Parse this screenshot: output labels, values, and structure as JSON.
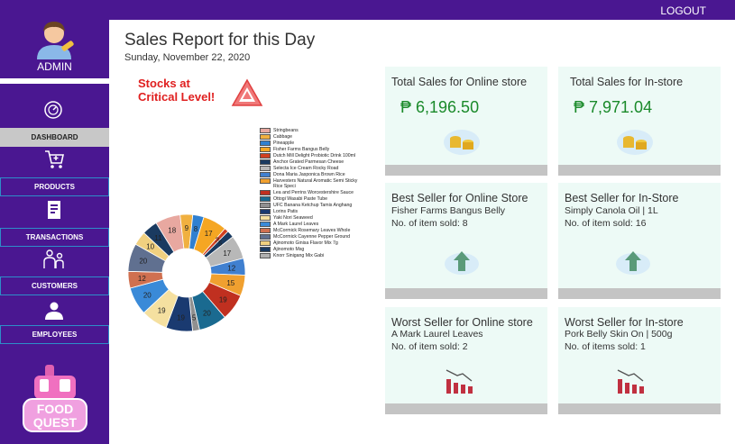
{
  "header": {
    "logout_label": "LOGOUT"
  },
  "sidebar": {
    "admin_label": "ADMIN",
    "items": [
      {
        "label": "DASHBOARD",
        "icon": "dashboard-icon"
      },
      {
        "label": "PRODUCTS",
        "icon": "cart-icon"
      },
      {
        "label": "TRANSACTIONS",
        "icon": "receipt-icon"
      },
      {
        "label": "CUSTOMERS",
        "icon": "customers-icon"
      },
      {
        "label": "EMPLOYEES",
        "icon": "employee-icon"
      }
    ],
    "logo_text": "FOOD QUEST"
  },
  "main": {
    "title": "Sales Report for this Day",
    "date": "Sunday, November 22, 2020",
    "critical_label": "Stocks at Critical Level!"
  },
  "cards": {
    "online_total": {
      "title": "Total Sales  for Online store",
      "amount": "₱ 6,196.50"
    },
    "instore_total": {
      "title": "Total Sales  for In-store",
      "amount": "₱ 7,971.04"
    },
    "best_online": {
      "title": "Best Seller for Online Store",
      "product": "Fisher Farms Bangus Belly",
      "sold": "No. of item sold: 8"
    },
    "best_instore": {
      "title": "Best Seller for In-Store",
      "product": "Simply Canola Oil | 1L",
      "sold": "No. of item sold: 16"
    },
    "worst_online": {
      "title": "Worst Seller for Online store",
      "product": "A Mark Laurel Leaves",
      "sold": "No. of item sold: 2"
    },
    "worst_instore": {
      "title": "Worst Seller for In-store",
      "product": "Pork Belly Skin On  | 500g",
      "sold": "No. of items sold: 1"
    }
  },
  "chart_data": {
    "type": "pie",
    "series": [
      {
        "name": "Stringbeans",
        "value": 18,
        "color": "#e8a8a0",
        "label": "18"
      },
      {
        "name": "Cabbage",
        "value": 9,
        "color": "#f0b040",
        "label": "9"
      },
      {
        "name": "Pineapple",
        "value": 8,
        "color": "#3080d0",
        "label": "8"
      },
      {
        "name": "Fisher Farms Bangus Belly",
        "value": 17,
        "color": "#f5a623",
        "label": "17"
      },
      {
        "name": "Dutch Mill Delight Probiotic Drink 100ml",
        "value": 3,
        "color": "#d04020",
        "label": "3"
      },
      {
        "name": "Anchor Grated Parmesan Cheese",
        "value": 5,
        "color": "#1a3a60",
        "label": "5"
      },
      {
        "name": "Selecta Ice Cream Rocky Road",
        "value": 17,
        "color": "#b8b8b8",
        "label": "17"
      },
      {
        "name": "Dona Maria Jasponica Brown Rice",
        "value": 12,
        "color": "#4080d0",
        "label": "12"
      },
      {
        "name": "Harvesters Natural Aromatic Semi Sticky Rice Speci",
        "value": 15,
        "color": "#f0a030",
        "label": "15"
      },
      {
        "name": "Lea and Perrins Worcestershire Sauce",
        "value": 19,
        "color": "#c03020",
        "label": "19"
      },
      {
        "name": "Ottogi Wasabi Paste Tube",
        "value": 20,
        "color": "#1a6a90",
        "label": "20"
      },
      {
        "name": "UFC Banana Ketchup Tamis Anghang",
        "value": 5,
        "color": "#909090",
        "label": "5"
      },
      {
        "name": "Lorins Patis",
        "value": 19,
        "color": "#1a3a70",
        "label": "19"
      },
      {
        "name": "Yaki Nori Seaweed",
        "value": 19,
        "color": "#f5e0a0",
        "label": "19"
      },
      {
        "name": "A Mark Laurel Leaves",
        "value": 20,
        "color": "#3a8ad8",
        "label": "20"
      },
      {
        "name": "McCormick Rosemary Leaves Whole",
        "value": 12,
        "color": "#d07050",
        "label": "12"
      },
      {
        "name": "McCormick Cayenne Pepper Ground",
        "value": 20,
        "color": "#607090",
        "label": "20"
      },
      {
        "name": "Ajinomoto Ginisa Flavor Mix 7g",
        "value": 10,
        "color": "#f0d080",
        "label": "10"
      },
      {
        "name": "Ajinomoto Msg",
        "value": 11,
        "color": "#1a3a60",
        "label": "11"
      },
      {
        "name": "Knorr Sinigang Mix Gabi",
        "value": 0,
        "color": "#b0b0b0",
        "label": ""
      }
    ]
  }
}
